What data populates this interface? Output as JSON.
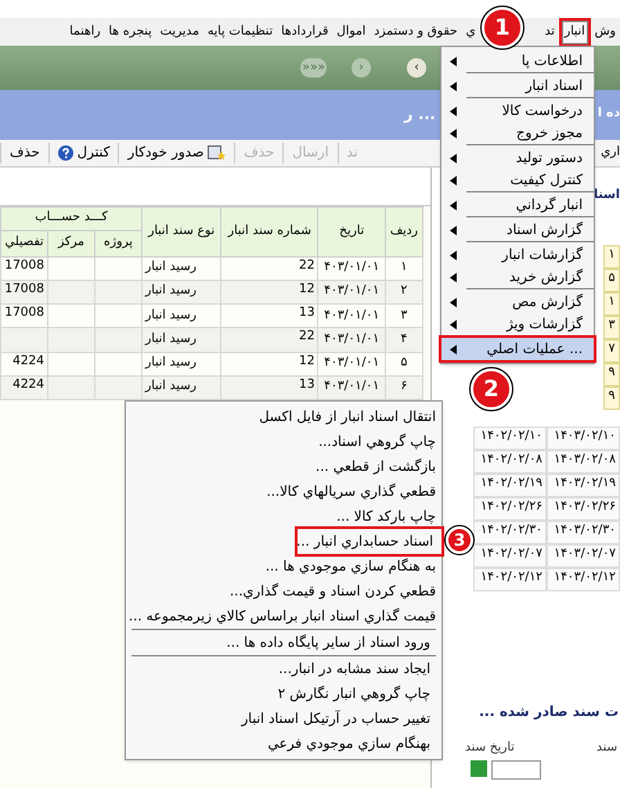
{
  "menu_bar": [
    {
      "label": "وش",
      "selected": false,
      "marked": false
    },
    {
      "label": "انبار",
      "selected": true,
      "marked": true
    },
    {
      "label": "تد",
      "selected": false,
      "marked": false
    },
    {
      "label": "ي",
      "selected": false,
      "marked": false
    },
    {
      "label": "حقوق و دستمزد",
      "selected": false,
      "marked": false
    },
    {
      "label": "اموال",
      "selected": false,
      "marked": false
    },
    {
      "label": "قراردادها",
      "selected": false,
      "marked": false
    },
    {
      "label": "تنظيمات پايه",
      "selected": false,
      "marked": false
    },
    {
      "label": "مديريت",
      "selected": false,
      "marked": false
    },
    {
      "label": "پنجره ها",
      "selected": false,
      "marked": false
    },
    {
      "label": "راهنما",
      "selected": false,
      "marked": false
    }
  ],
  "nav_buttons": [
    {
      "kind": "next",
      "label": "›",
      "disabled": false
    },
    {
      "kind": "prev",
      "label": "‹",
      "disabled": true
    },
    {
      "kind": "first",
      "label": "«««",
      "disabled": true
    }
  ],
  "window_title": {
    "right_part": "ده ا",
    "left_part": "ر ..."
  },
  "toolbar": {
    "right_part": "اري",
    "items": [
      {
        "label": "ند",
        "kind": "plain",
        "disabled": true
      },
      {
        "label": "ارسال",
        "kind": "plain",
        "disabled": true
      },
      {
        "label": "حذف",
        "kind": "plain",
        "disabled": true
      },
      {
        "label": "صدور خودکار",
        "kind": "auto",
        "disabled": false
      },
      {
        "label": "کنترل",
        "kind": "help",
        "disabled": false
      },
      {
        "label": "حذف",
        "kind": "plain",
        "disabled": false
      }
    ]
  },
  "table": {
    "group_header": "کـــد حســـاب",
    "columns": [
      "رديف",
      "تاريخ",
      "شماره سند انبار",
      "نوع سند انبار",
      "پروژه",
      "مرکز",
      "تفصيلي"
    ],
    "rows": [
      [
        "١",
        "۴۰۳/۰۱/۰۱",
        "22",
        "رسيد انبار",
        "",
        "",
        "17008"
      ],
      [
        "٢",
        "۴۰۳/۰۱/۰۱",
        "12",
        "رسيد انبار",
        "",
        "",
        "17008"
      ],
      [
        "٣",
        "۴۰۳/۰۱/۰۱",
        "13",
        "رسيد انبار",
        "",
        "",
        "17008"
      ],
      [
        "۴",
        "۴۰۳/۰۱/۰۱",
        "22",
        "رسيد انبار",
        "",
        "",
        ""
      ],
      [
        "۵",
        "۴۰۳/۰۱/۰۱",
        "12",
        "رسيد انبار",
        "",
        "",
        "4224"
      ],
      [
        "۶",
        "۴۰۳/۰۱/۰۱",
        "13",
        "رسيد انبار",
        "",
        "",
        "4224"
      ]
    ]
  },
  "side_panel": {
    "heading": "اسنا",
    "top_numbers": [
      "١",
      "۵",
      "١",
      "٣",
      "٧",
      "٩",
      "٩"
    ],
    "date_rows": [
      [
        "۱۴۰۳/۰۲/۱۰",
        "۱۴۰۲/۰۲/۱۰"
      ],
      [
        "۱۴۰۳/۰۲/۰۸",
        "۱۴۰۲/۰۲/۰۸"
      ],
      [
        "۱۴۰۳/۰۲/۱۹",
        "۱۴۰۲/۰۲/۱۹"
      ],
      [
        "۱۴۰۳/۰۲/۲۶",
        "۱۴۰۲/۰۲/۲۶"
      ],
      [
        "۱۴۰۳/۰۲/۳۰",
        "۱۴۰۲/۰۲/۳۰"
      ],
      [
        "۱۴۰۳/۰۲/۰۷",
        "۱۴۰۲/۰۲/۰۷"
      ],
      [
        "۱۴۰۳/۰۲/۱۲",
        "۱۴۰۲/۰۲/۱۲"
      ]
    ],
    "bottom_title": "ت سند صادر شده ...",
    "field_labels": [
      "سند",
      "تاريخ سند"
    ]
  },
  "dropdown_menu": {
    "groups": [
      [
        {
          "label": "اطلاعات پا",
          "selected": false,
          "marked": false
        }
      ],
      [
        {
          "label": "اسناد انبار",
          "selected": false,
          "marked": false
        }
      ],
      [
        {
          "label": "درخواست کالا",
          "selected": false,
          "marked": false
        },
        {
          "label": "مجوز خروج",
          "selected": false,
          "marked": false
        }
      ],
      [
        {
          "label": "دستور توليد",
          "selected": false,
          "marked": false
        },
        {
          "label": "کنترل کيفيت",
          "selected": false,
          "marked": false
        }
      ],
      [
        {
          "label": "انبار گرداني",
          "selected": false,
          "marked": false
        }
      ],
      [
        {
          "label": "گزارش اسناد",
          "selected": false,
          "marked": false
        }
      ],
      [
        {
          "label": "گزارشات انبار",
          "selected": false,
          "marked": false
        },
        {
          "label": "گزارش خريد",
          "selected": false,
          "marked": false
        }
      ],
      [
        {
          "label": "گزارش مص",
          "selected": false,
          "marked": false
        },
        {
          "label": "گزارشات ويژ",
          "selected": false,
          "marked": false
        }
      ],
      [
        {
          "label": "عمليات اصلي ...",
          "selected": true,
          "marked": true
        }
      ]
    ]
  },
  "submenu": {
    "groups": [
      [
        {
          "label": "انتقال اسناد انبار از فايل اکسل",
          "marked": false
        },
        {
          "label": "چاپ گروهي اسناد...",
          "marked": false
        },
        {
          "label": "بازگشت از قطعي ...",
          "marked": false
        },
        {
          "label": "قطعي گذاري سريالهاي کالا...",
          "marked": false
        },
        {
          "label": "چاپ بارکد کالا ...",
          "marked": false
        },
        {
          "label": "اسناد حسابداري انبار ...",
          "marked": true
        },
        {
          "label": "به هنگام سازي موجودي ها ...",
          "marked": false
        },
        {
          "label": "قطعي کردن اسناد و قيمت گذاري...",
          "marked": false
        },
        {
          "label": "قيمت گذاري اسناد انبار براساس کالاي زيرمجموعه ...",
          "marked": false
        }
      ],
      [
        {
          "label": "ورود اسناد از ساير پايگاه داده ها ...",
          "marked": false
        }
      ],
      [
        {
          "label": "ايجاد سند مشابه در انبار...",
          "marked": false
        },
        {
          "label": "چاپ گروهي انبار نگارش ٢",
          "marked": false
        },
        {
          "label": "تغيير حساب در آرتيکل اسناد انبار",
          "marked": false
        },
        {
          "label": "بهنگام سازي موجودي فرعي",
          "marked": false
        }
      ]
    ]
  },
  "steps": [
    "1",
    "2",
    "3"
  ]
}
